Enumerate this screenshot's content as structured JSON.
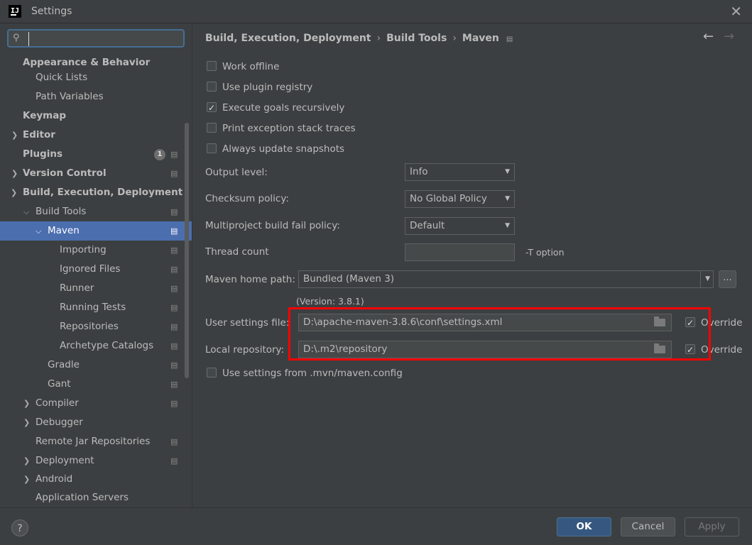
{
  "window": {
    "title": "Settings",
    "logo_text": "IJ"
  },
  "search": {
    "value": "",
    "placeholder": ""
  },
  "sidebar": {
    "items": [
      {
        "label": "Appearance & Behavior"
      },
      {
        "label": "Quick Lists"
      },
      {
        "label": "Path Variables"
      },
      {
        "label": "Keymap"
      },
      {
        "label": "Editor"
      },
      {
        "label": "Plugins",
        "badge": "1"
      },
      {
        "label": "Version Control"
      },
      {
        "label": "Build, Execution, Deployment"
      },
      {
        "label": "Build Tools"
      },
      {
        "label": "Maven"
      },
      {
        "label": "Importing"
      },
      {
        "label": "Ignored Files"
      },
      {
        "label": "Runner"
      },
      {
        "label": "Running Tests"
      },
      {
        "label": "Repositories"
      },
      {
        "label": "Archetype Catalogs"
      },
      {
        "label": "Gradle"
      },
      {
        "label": "Gant"
      },
      {
        "label": "Compiler"
      },
      {
        "label": "Debugger"
      },
      {
        "label": "Remote Jar Repositories"
      },
      {
        "label": "Deployment"
      },
      {
        "label": "Android"
      },
      {
        "label": "Application Servers"
      }
    ]
  },
  "breadcrumb": {
    "part1": "Build, Execution, Deployment",
    "part2": "Build Tools",
    "part3": "Maven",
    "sep": "›"
  },
  "options": {
    "work_offline": "Work offline",
    "use_plugin_registry": "Use plugin registry",
    "execute_goals_recursively": "Execute goals recursively",
    "print_exception_stack_traces": "Print exception stack traces",
    "always_update_snapshots": "Always update snapshots",
    "use_mvn_config": "Use settings from .mvn/maven.config"
  },
  "fields": {
    "output_level_label": "Output level:",
    "output_level_value": "Info",
    "checksum_policy_label": "Checksum policy:",
    "checksum_policy_value": "No Global Policy",
    "multiproject_label": "Multiproject build fail policy:",
    "multiproject_value": "Default",
    "thread_count_label": "Thread count",
    "thread_count_value": "",
    "thread_count_hint": "-T option",
    "maven_home_label": "Maven home path:",
    "maven_home_value": "Bundled (Maven 3)",
    "maven_home_browse": "...",
    "version_text": "(Version: 3.8.1)",
    "user_settings_label": "User settings file:",
    "user_settings_value": "D:\\apache-maven-3.8.6\\conf\\settings.xml",
    "local_repo_label": "Local repository:",
    "local_repo_value": "D:\\.m2\\repository",
    "override_label": "Override"
  },
  "footer": {
    "help": "?",
    "ok": "OK",
    "cancel": "Cancel",
    "apply": "Apply"
  },
  "colors": {
    "accent": "#4b6eaf",
    "highlight_box": "#ff0000",
    "primary_button": "#365880"
  }
}
